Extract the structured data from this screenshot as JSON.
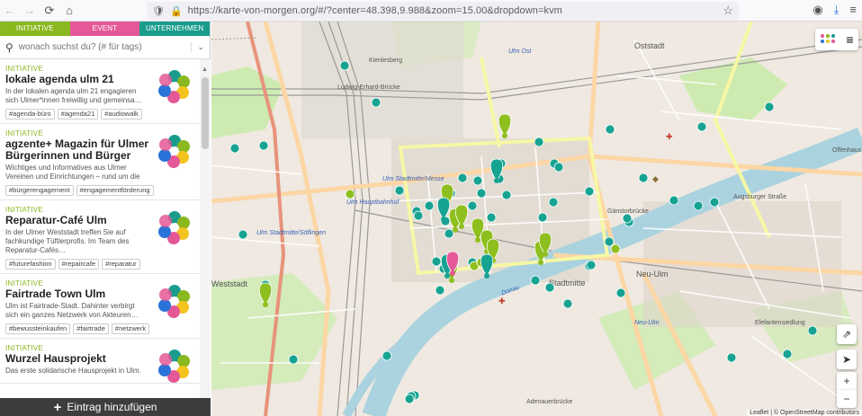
{
  "browser": {
    "url": "https://karte-von-morgen.org/#/?center=48.398,9.988&zoom=15.00&dropdown=kvm"
  },
  "sidebar": {
    "tabs": [
      "INITIATIVE",
      "EVENT",
      "UNTERNEHMEN"
    ],
    "search": {
      "placeholder": "wonach suchst du? (# für tags)"
    },
    "entries": [
      {
        "category": "INITIATIVE",
        "title": "lokale agenda ulm 21",
        "description": "In der lokalen agenda ulm 21 engagieren sich Ulmer*innen freiwillig und gemeinsa…",
        "tags": [
          "#agenda-büro",
          "#agenda21",
          "#audiowalk"
        ]
      },
      {
        "category": "INITIATIVE",
        "title": "agzente+ Magazin für Ulmer Bürgerinnen und Bürger",
        "description": "Wichtiges und Informatives aus Ulmer Vereinen und Einrichtungen – rund um die",
        "tags": [
          "#bürgerengagement",
          "#engagementförderung"
        ]
      },
      {
        "category": "INITIATIVE",
        "title": "Reparatur-Café Ulm",
        "description": "In der Ulmer Weststadt treffen Sie auf fachkundige Tüftlerprofis. Im Team des Reparatur-Cafés…",
        "tags": [
          "#futurefashion",
          "#repaircafe",
          "#reparatur"
        ]
      },
      {
        "category": "INITIATIVE",
        "title": "Fairtrade Town Ulm",
        "description": "Ulm ist Fairtrade-Stadt. Dahinter verbirgt sich ein ganzes Netzwerk von Akteuren…",
        "tags": [
          "#bewussteinkaufen",
          "#fairtrade",
          "#netzwerk"
        ]
      },
      {
        "category": "INITIATIVE",
        "title": "Wurzel Hausprojekt",
        "description": "Das erste solidarische Hausprojekt in Ulm.",
        "tags": []
      }
    ],
    "add_button": "Eintrag hinzufügen"
  },
  "map": {
    "labels": {
      "oststadt": "Oststadt",
      "weststadt": "Weststadt",
      "stadtmitte": "Stadtmitte",
      "neu_ulm": "Neu-Ulm",
      "ulm_hbf": "Ulm Hauptbahnhof",
      "ulm_ost": "Ulm Ost",
      "offenhausen": "Offenhaus",
      "neu_ulm_station": "Neu-Ulm",
      "donau": "Donau",
      "ulm_stadtmitte_messe": "Ulm Stadtmitte/Messe",
      "ludwig_erhard": "Ludwig-Erhard-Brücke",
      "kienlesberg": "Kienlesberg",
      "eichenplatzsiedlung": "Elefantensiedlung",
      "ulm_stadtmitte_soeflingen": "Ulm Stadtmitte/Söflingen",
      "augsburger_strasse": "Augsburger Straße",
      "gaenstorbrucke": "Gänstorbrücke",
      "adenauerbruecke": "Adenauerbrücke"
    },
    "controls": {
      "share": "share-icon",
      "locate": "locate-icon",
      "zoom_in": "+",
      "zoom_out": "−"
    },
    "attribution": "Leaflet | © OpenStreetMap contributors",
    "colors": {
      "initiative": "#8fbf1f",
      "company": "#17a392",
      "event": "#e45897"
    }
  }
}
